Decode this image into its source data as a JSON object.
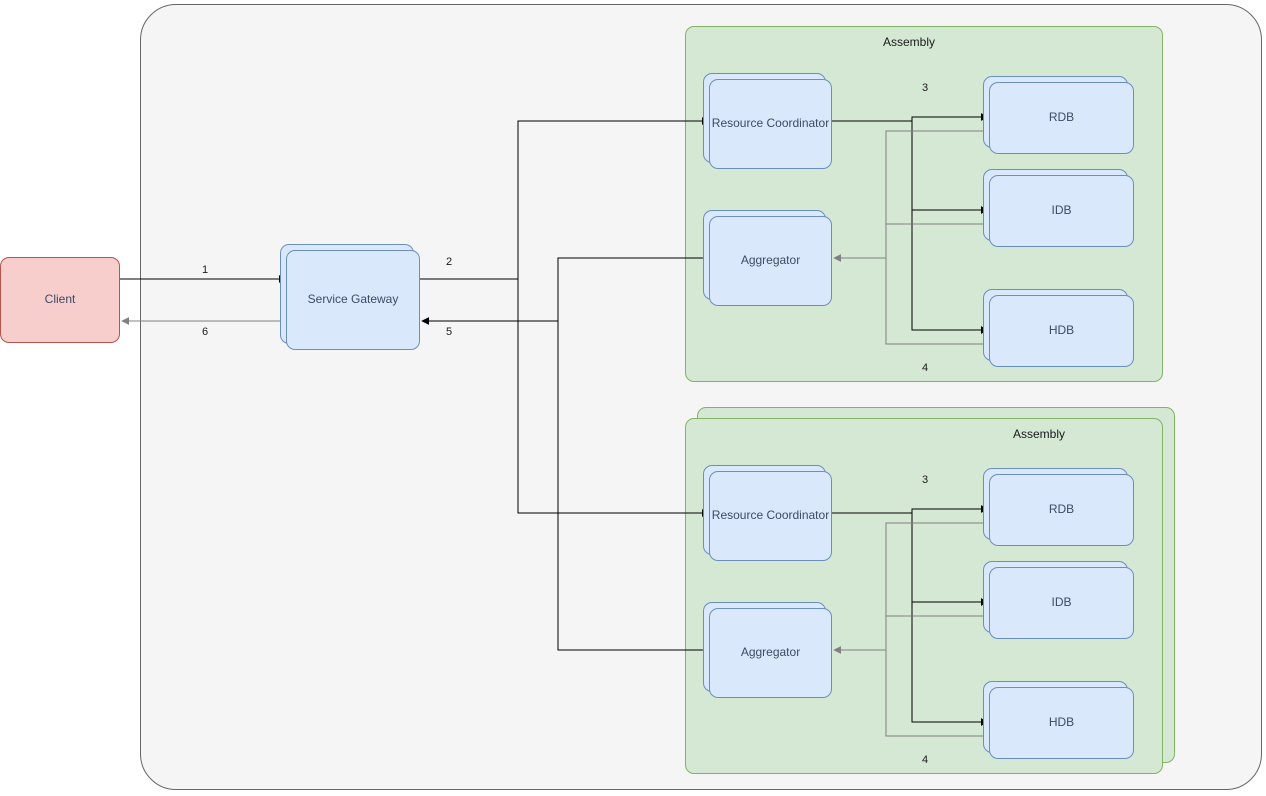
{
  "nodes": {
    "client": "Client",
    "serviceGateway": "Service Gateway",
    "resourceCoordinator": "Resource Coordinator",
    "aggregator": "Aggregator",
    "rdb": "RDB",
    "idb": "IDB",
    "hdb": "HDB"
  },
  "groups": {
    "assembly": "Assembly"
  },
  "edgeLabels": {
    "l1": "1",
    "l2": "2",
    "l3a": "3",
    "l3b": "3",
    "l4a": "4",
    "l4b": "4",
    "l5": "5",
    "l6": "6"
  },
  "colors": {
    "clientFill": "#f8cecc",
    "clientStroke": "#b85450",
    "blueFill": "#dae8fc",
    "blueStroke": "#6c8ebf",
    "greenFill": "#d5e8d4",
    "greenStroke": "#82b366",
    "frameFill": "#f5f5f5",
    "frameStroke": "#666666",
    "arrowBlack": "#000000",
    "arrowGrey": "#808080"
  },
  "chart_data": {
    "type": "diagram",
    "direction": "LR",
    "nodes": [
      {
        "id": "client",
        "label": "Client",
        "kind": "client"
      },
      {
        "id": "gateway",
        "label": "Service Gateway",
        "kind": "service",
        "stacked": true
      },
      {
        "id": "asm1",
        "label": "Assembly",
        "kind": "group"
      },
      {
        "id": "asm1_rc",
        "label": "Resource Coordinator",
        "kind": "service",
        "group": "asm1",
        "stacked": true
      },
      {
        "id": "asm1_agg",
        "label": "Aggregator",
        "kind": "service",
        "group": "asm1",
        "stacked": true
      },
      {
        "id": "asm1_rdb",
        "label": "RDB",
        "kind": "db",
        "group": "asm1",
        "stacked": true
      },
      {
        "id": "asm1_idb",
        "label": "IDB",
        "kind": "db",
        "group": "asm1",
        "stacked": true
      },
      {
        "id": "asm1_hdb",
        "label": "HDB",
        "kind": "db",
        "group": "asm1",
        "stacked": true
      },
      {
        "id": "asm2",
        "label": "Assembly",
        "kind": "group",
        "stacked": true
      },
      {
        "id": "asm2_rc",
        "label": "Resource Coordinator",
        "kind": "service",
        "group": "asm2",
        "stacked": true
      },
      {
        "id": "asm2_agg",
        "label": "Aggregator",
        "kind": "service",
        "group": "asm2",
        "stacked": true
      },
      {
        "id": "asm2_rdb",
        "label": "RDB",
        "kind": "db",
        "group": "asm2",
        "stacked": true
      },
      {
        "id": "asm2_idb",
        "label": "IDB",
        "kind": "db",
        "group": "asm2",
        "stacked": true
      },
      {
        "id": "asm2_hdb",
        "label": "HDB",
        "kind": "db",
        "group": "asm2",
        "stacked": true
      }
    ],
    "edges": [
      {
        "from": "client",
        "to": "gateway",
        "label": "1",
        "style": "black"
      },
      {
        "from": "gateway",
        "to": "client",
        "label": "6",
        "style": "grey"
      },
      {
        "from": "gateway",
        "to": "asm1_rc",
        "label": "2",
        "style": "black"
      },
      {
        "from": "gateway",
        "to": "asm2_rc",
        "label": "2",
        "style": "black"
      },
      {
        "from": "asm1_agg",
        "to": "gateway",
        "label": "5",
        "style": "black"
      },
      {
        "from": "asm2_agg",
        "to": "gateway",
        "label": "5",
        "style": "black"
      },
      {
        "from": "asm1_rc",
        "to": "asm1_rdb",
        "label": "3",
        "style": "black"
      },
      {
        "from": "asm1_rc",
        "to": "asm1_idb",
        "label": "3",
        "style": "black"
      },
      {
        "from": "asm1_rc",
        "to": "asm1_hdb",
        "label": "3",
        "style": "black"
      },
      {
        "from": "asm1_rdb",
        "to": "asm1_agg",
        "label": "4",
        "style": "grey"
      },
      {
        "from": "asm1_idb",
        "to": "asm1_agg",
        "label": "4",
        "style": "grey"
      },
      {
        "from": "asm1_hdb",
        "to": "asm1_agg",
        "label": "4",
        "style": "grey"
      },
      {
        "from": "asm2_rc",
        "to": "asm2_rdb",
        "label": "3",
        "style": "black"
      },
      {
        "from": "asm2_rc",
        "to": "asm2_idb",
        "label": "3",
        "style": "black"
      },
      {
        "from": "asm2_rc",
        "to": "asm2_hdb",
        "label": "3",
        "style": "black"
      },
      {
        "from": "asm2_rdb",
        "to": "asm2_agg",
        "label": "4",
        "style": "grey"
      },
      {
        "from": "asm2_idb",
        "to": "asm2_agg",
        "label": "4",
        "style": "grey"
      },
      {
        "from": "asm2_hdb",
        "to": "asm2_agg",
        "label": "4",
        "style": "grey"
      }
    ]
  }
}
